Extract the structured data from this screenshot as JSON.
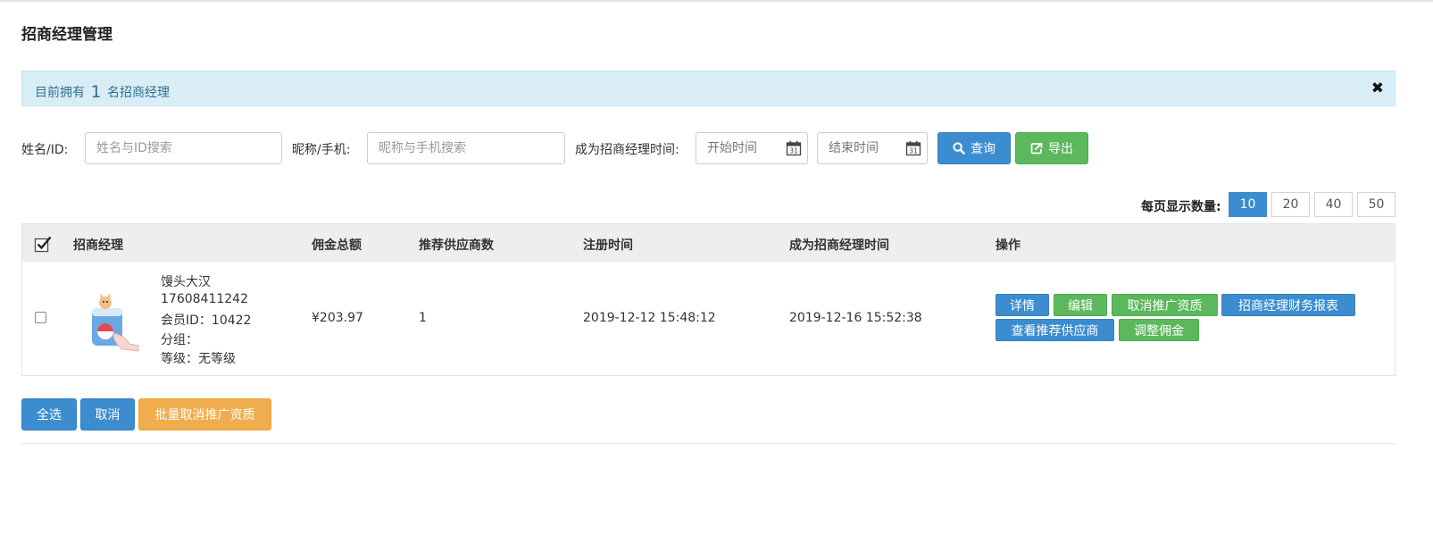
{
  "page": {
    "title": "招商经理管理"
  },
  "alert": {
    "prefix": "目前拥有",
    "count": "1",
    "suffix": "名招商经理",
    "close_icon": "close-icon"
  },
  "search": {
    "name_label": "姓名/ID:",
    "name_placeholder": "姓名与ID搜索",
    "nick_label": "昵称/手机:",
    "nick_placeholder": "昵称与手机搜索",
    "time_label": "成为招商经理时间:",
    "start_placeholder": "开始时间",
    "end_placeholder": "结束时间",
    "query_label": "查询",
    "export_label": "导出"
  },
  "page_size": {
    "label": "每页显示数量:",
    "options": [
      "10",
      "20",
      "40",
      "50"
    ],
    "selected": "10"
  },
  "table": {
    "headers": {
      "manager": "招商经理",
      "commission": "佣金总额",
      "suppliers": "推荐供应商数",
      "register_time": "注册时间",
      "manager_time": "成为招商经理时间",
      "actions": "操作"
    },
    "rows": [
      {
        "name": "馒头大汉",
        "phone": "17608411242",
        "member_id": "会员ID：10422",
        "group": "分组：",
        "level": "等级：无等级",
        "commission": "¥203.97",
        "suppliers": "1",
        "register_time": "2019-12-12 15:48:12",
        "manager_time": "2019-12-16 15:52:38",
        "actions": {
          "detail": "详情",
          "edit": "编辑",
          "cancel_promo": "取消推广资质",
          "finance_report": "招商经理财务报表",
          "view_suppliers": "查看推荐供应商",
          "adjust_commission": "调整佣金"
        }
      }
    ]
  },
  "bulk": {
    "select_all": "全选",
    "cancel": "取消",
    "batch_cancel": "批量取消推广资质"
  },
  "colors": {
    "primary": "#3c8dcf",
    "success": "#5cb85c",
    "warning": "#f0ad4e",
    "info_bg": "#d9edf7",
    "info_text": "#31708f"
  }
}
